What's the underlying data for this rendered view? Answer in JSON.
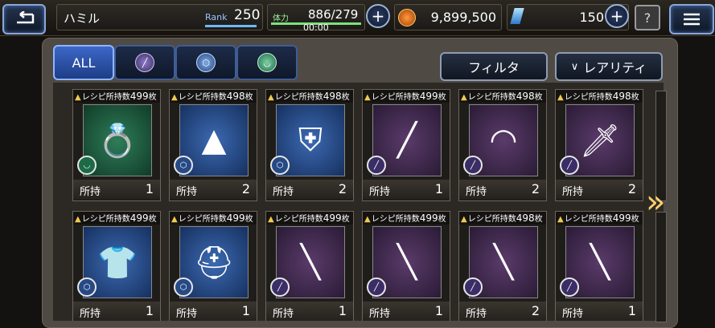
{
  "header": {
    "player_name": "ハミル",
    "rank_label": "Rank",
    "rank_value": "250",
    "stamina_label": "体力",
    "stamina_value": "886/279",
    "stamina_fill": 1.0,
    "stamina_timer": "00:00",
    "gil_amount": "9,899,500",
    "crystal_amount": "150",
    "help_label": "?"
  },
  "tabs": [
    {
      "label": "ALL",
      "icon": "all"
    },
    {
      "label": "",
      "icon": "weapon-icon"
    },
    {
      "label": "",
      "icon": "armor-icon"
    },
    {
      "label": "",
      "icon": "accessory-icon"
    }
  ],
  "filter_label": "フィルタ",
  "sort_label": "レアリティ",
  "sort_chevron": "∨",
  "card_common": {
    "recipe_label": "レシピ所持数",
    "unit": "枚",
    "owned_label": "所持"
  },
  "cards": [
    {
      "recipe_count": "499",
      "qty": "1",
      "icon": "ring-icon",
      "bg": "green"
    },
    {
      "recipe_count": "498",
      "qty": "2",
      "icon": "hat-icon",
      "bg": "blue"
    },
    {
      "recipe_count": "498",
      "qty": "2",
      "icon": "armor-icon",
      "bg": "blue"
    },
    {
      "recipe_count": "499",
      "qty": "1",
      "icon": "spear-icon",
      "bg": "purple"
    },
    {
      "recipe_count": "498",
      "qty": "2",
      "icon": "bow-icon",
      "bg": "purple"
    },
    {
      "recipe_count": "498",
      "qty": "2",
      "icon": "dagger-icon",
      "bg": "purple"
    },
    {
      "recipe_count": "499",
      "qty": "1",
      "icon": "robe-icon",
      "bg": "blue"
    },
    {
      "recipe_count": "499",
      "qty": "1",
      "icon": "helmet-icon",
      "bg": "blue"
    },
    {
      "recipe_count": "499",
      "qty": "1",
      "icon": "rod-icon",
      "bg": "purple"
    },
    {
      "recipe_count": "499",
      "qty": "1",
      "icon": "gun-icon",
      "bg": "purple"
    },
    {
      "recipe_count": "498",
      "qty": "2",
      "icon": "spearhead-icon",
      "bg": "purple"
    },
    {
      "recipe_count": "499",
      "qty": "1",
      "icon": "trident-icon",
      "bg": "purple"
    }
  ]
}
